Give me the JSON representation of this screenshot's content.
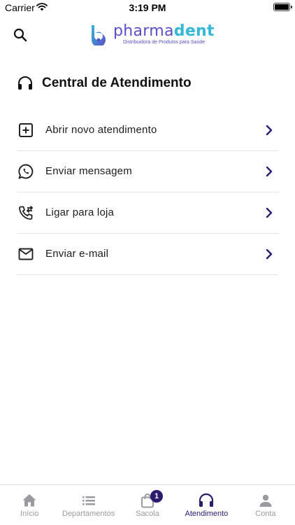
{
  "status_bar": {
    "carrier": "Carrier",
    "time": "3:19 PM"
  },
  "header": {
    "logo_text_part1": "pharma",
    "logo_text_part2": "dent",
    "logo_tagline": "Distribuidora de Produtos para Saúde"
  },
  "section": {
    "title": "Central de Atendimento",
    "icon": "headphones-icon"
  },
  "menu": {
    "items": [
      {
        "label": "Abrir novo atendimento",
        "icon": "plus-square-icon"
      },
      {
        "label": "Enviar mensagem",
        "icon": "whatsapp-icon"
      },
      {
        "label": "Ligar para loja",
        "icon": "phone-forwarded-icon"
      },
      {
        "label": "Enviar e-mail",
        "icon": "mail-icon"
      }
    ]
  },
  "tab_bar": {
    "tabs": [
      {
        "label": "Início",
        "icon": "home-icon",
        "active": false
      },
      {
        "label": "Departamentos",
        "icon": "list-icon",
        "active": false
      },
      {
        "label": "Sacola",
        "icon": "bag-icon",
        "active": false,
        "badge": "1"
      },
      {
        "label": "Atendimento",
        "icon": "headphones-icon",
        "active": true
      },
      {
        "label": "Conta",
        "icon": "person-icon",
        "active": false
      }
    ]
  },
  "colors": {
    "accent": "#2e1a6e",
    "logo_primary": "#5a4fc8",
    "logo_secondary": "#33b8d6",
    "inactive": "#9a9aa0"
  }
}
